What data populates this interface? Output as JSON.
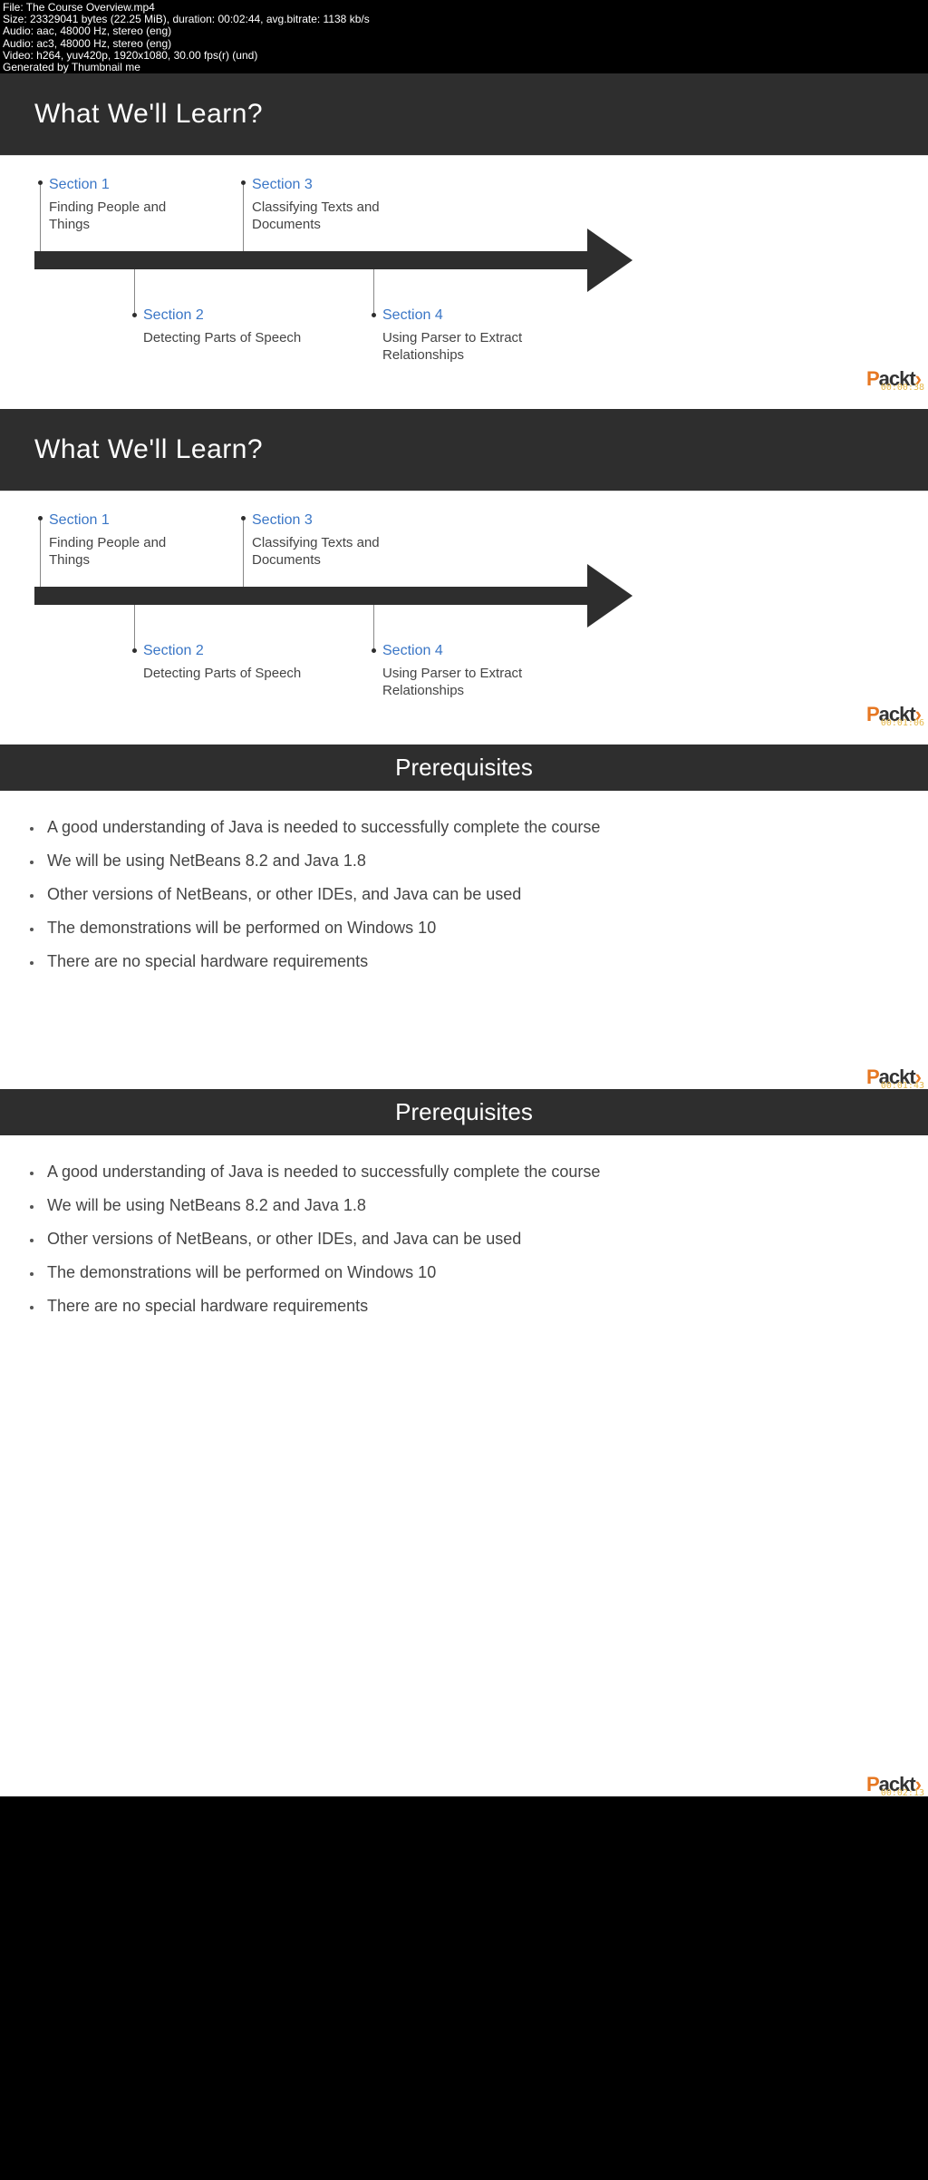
{
  "meta": {
    "file": "File: The Course Overview.mp4",
    "size": "Size: 23329041 bytes (22.25 MiB), duration: 00:02:44, avg.bitrate: 1138 kb/s",
    "audio1": "Audio: aac, 48000 Hz, stereo (eng)",
    "audio2": "Audio: ac3, 48000 Hz, stereo (eng)",
    "video": "Video: h264, yuv420p, 1920x1080, 30.00 fps(r) (und)",
    "gen": "Generated by Thumbnail me"
  },
  "learn": {
    "title": "What We'll Learn?",
    "sec1": {
      "title": "Section 1",
      "desc": "Finding People and Things"
    },
    "sec2": {
      "title": "Section 2",
      "desc": "Detecting Parts of Speech"
    },
    "sec3": {
      "title": "Section 3",
      "desc": "Classifying Texts and Documents"
    },
    "sec4": {
      "title": "Section 4",
      "desc": "Using Parser to Extract Relationships"
    }
  },
  "prereq": {
    "title": "Prerequisites",
    "items": [
      "A good understanding of Java is needed to successfully complete the course",
      "We will be using NetBeans 8.2 and Java 1.8",
      "Other versions of NetBeans, or other IDEs, and Java can be used",
      "The demonstrations will be performed on Windows 10",
      "There are no special hardware requirements"
    ]
  },
  "logo": {
    "p": "P",
    "ackt": "ackt",
    "br": "›"
  },
  "timestamps": {
    "t1": "00:00:38",
    "t2": "00:01:06",
    "t3": "00:01:43",
    "t4": "00:02:13"
  }
}
